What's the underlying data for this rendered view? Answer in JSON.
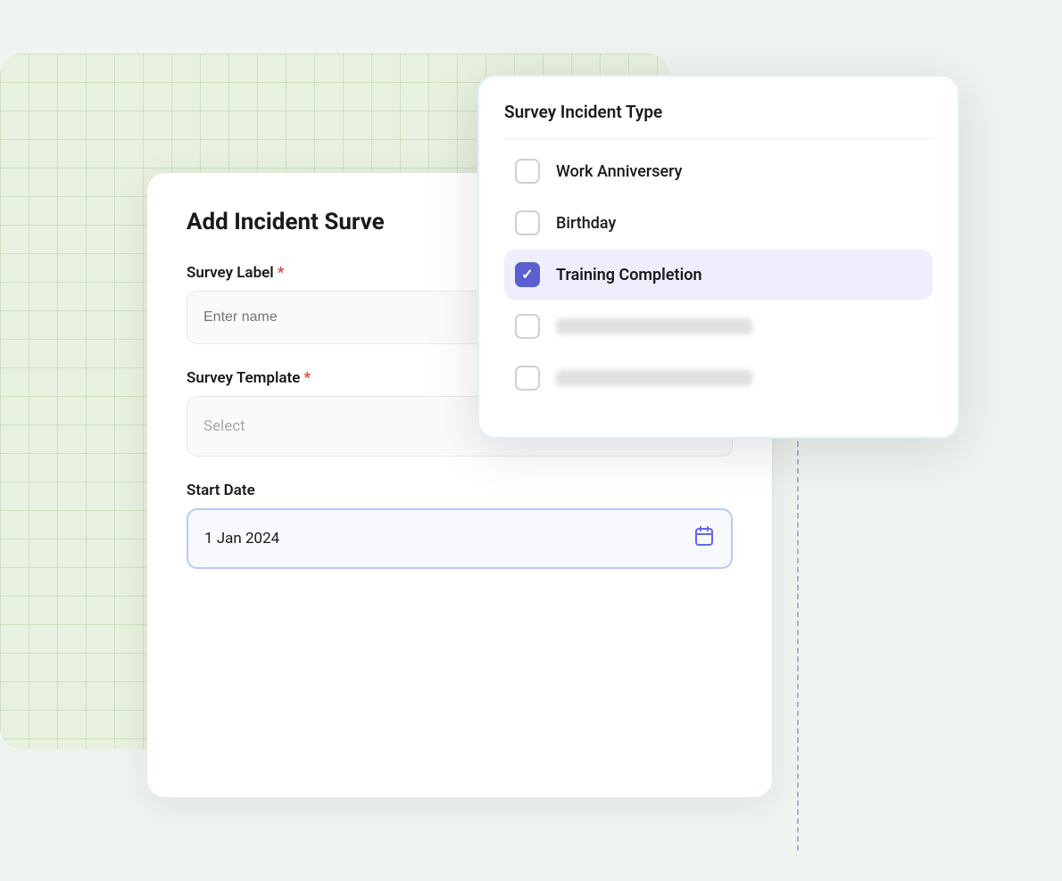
{
  "scene": {
    "form_title": "Add Incident Surve",
    "fields": {
      "survey_label": {
        "label": "Survey Label",
        "placeholder": "Enter name",
        "required": true
      },
      "survey_template": {
        "label": "Survey Template",
        "placeholder": "Select",
        "required": true
      },
      "start_date": {
        "label": "Start Date",
        "value": "1 Jan 2024",
        "required": false
      }
    }
  },
  "dropdown": {
    "title": "Survey Incident Type",
    "items": [
      {
        "id": "work_anniversary",
        "label": "Work Anniversery",
        "checked": false
      },
      {
        "id": "birthday",
        "label": "Birthday",
        "checked": false
      },
      {
        "id": "training_completion",
        "label": "Training Completion",
        "checked": true
      },
      {
        "id": "blurred_1",
        "label": "",
        "checked": false,
        "blurred": true
      },
      {
        "id": "blurred_2",
        "label": "",
        "checked": false,
        "blurred": true
      }
    ]
  },
  "icons": {
    "chevron_down": "❯",
    "calendar": "📅",
    "checkmark": "✓"
  }
}
